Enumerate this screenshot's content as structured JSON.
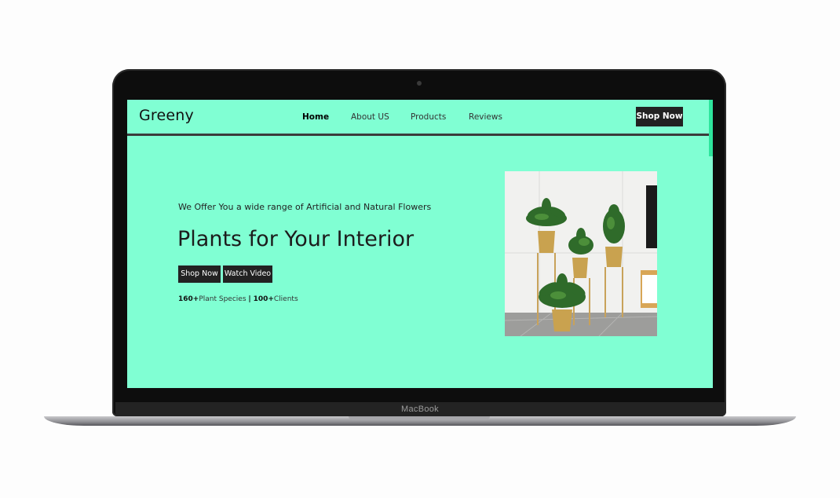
{
  "device": {
    "brand_label": "MacBook"
  },
  "site": {
    "logo": "Greeny",
    "nav": {
      "items": [
        {
          "label": "Home",
          "active": true
        },
        {
          "label": "About US",
          "active": false
        },
        {
          "label": "Products",
          "active": false
        },
        {
          "label": "Reviews",
          "active": false
        }
      ],
      "cta_label": "Shop Now"
    },
    "hero": {
      "subtitle": "We Offer You a wide range of Artificial and Natural Flowers",
      "title": "Plants for Your Interior",
      "primary_button": "Shop Now",
      "secondary_button": "Watch Video",
      "stats": {
        "species_count": "160+",
        "species_label": "Plant Species",
        "separator": "|",
        "clients_count": "100+",
        "clients_label": "Clients"
      }
    }
  },
  "colors": {
    "screen_background": "#80ffd3",
    "button_background": "#222222",
    "accent_strip": "#2ee59d"
  }
}
